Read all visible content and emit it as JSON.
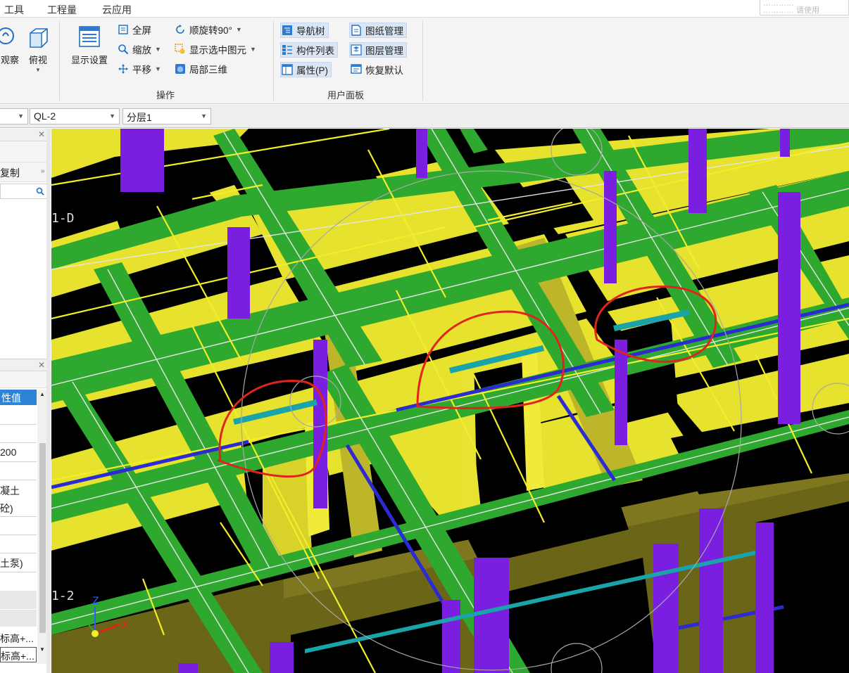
{
  "menubar": {
    "items": [
      "工具",
      "工程量",
      "云应用"
    ],
    "right_box_lines": [
      "…………",
      "………… 请使用"
    ]
  },
  "ribbon": {
    "view_buttons": [
      {
        "label": "观察",
        "icon": "observe-icon"
      },
      {
        "label": "俯视",
        "icon": "top-view-cube-icon"
      }
    ],
    "display_settings": {
      "label": "显示设置",
      "icon": "display-settings-icon"
    },
    "operations": {
      "group_label": "操作",
      "items": [
        {
          "label": "全屏",
          "icon": "fullscreen-icon",
          "has_dropdown": false
        },
        {
          "label": "顺旋转90°",
          "icon": "rotate-icon",
          "has_dropdown": true
        },
        {
          "label": "缩放",
          "icon": "zoom-icon",
          "has_dropdown": true
        },
        {
          "label": "显示选中图元",
          "icon": "show-selected-icon",
          "has_dropdown": true
        },
        {
          "label": "平移",
          "icon": "pan-icon",
          "has_dropdown": true
        },
        {
          "label": "局部三维",
          "icon": "local-3d-icon",
          "has_dropdown": false
        }
      ]
    },
    "user_panel": {
      "group_label": "用户面板",
      "items": [
        {
          "label": "导航树",
          "icon": "nav-tree-icon",
          "active": true
        },
        {
          "label": "图纸管理",
          "icon": "drawing-manage-icon",
          "active": true
        },
        {
          "label": "构件列表",
          "icon": "component-list-icon",
          "active": true
        },
        {
          "label": "图层管理",
          "icon": "layer-manage-icon",
          "active": true
        },
        {
          "label": "属性(P)",
          "icon": "properties-icon",
          "active": true
        },
        {
          "label": "恢复默认",
          "icon": "restore-default-icon",
          "active": false
        }
      ]
    }
  },
  "selectors": {
    "first": "",
    "component": "QL-2",
    "layer": "分层1"
  },
  "left_panel": {
    "top_items": [
      "复制"
    ],
    "search_icon": "search-icon",
    "props_header": "性值",
    "props_values": [
      "200",
      "凝土",
      "砼)",
      "土泵)",
      "标高+...",
      "标高+..."
    ]
  },
  "viewport": {
    "axis_labels": [
      "1-D",
      "1-2"
    ],
    "axis_gizmo": {
      "x": "X",
      "y": "Y",
      "z": "Z"
    },
    "colors": {
      "beam": "#2fa82f",
      "slab": "#e6e22e",
      "column": "#7a1fe0",
      "wall_dark": "#6b6518",
      "lintel": "#1aa3a8",
      "rebar": "#2b2bd1",
      "markup": "#e0241d"
    }
  }
}
